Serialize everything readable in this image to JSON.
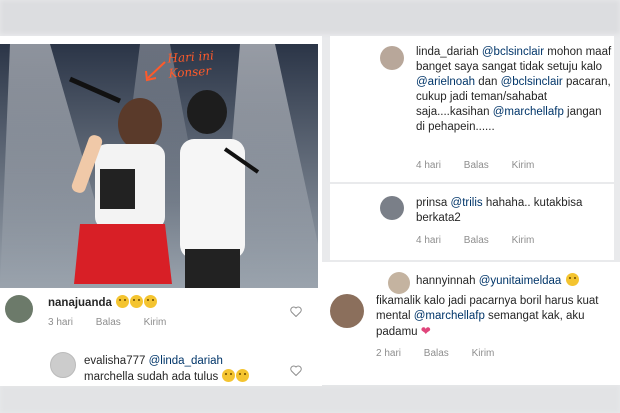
{
  "left": {
    "annotation": "Hari ini\nKonser",
    "comments": [
      {
        "user": "nanajuanda",
        "time": "3 hari",
        "reply": "Balas",
        "send": "Kirim"
      }
    ],
    "reply_comment": {
      "user": "evalisha777",
      "mention": "@linda_dariah",
      "text": "marchella sudah ada tulus"
    }
  },
  "right": {
    "comments": [
      {
        "user": "linda_dariah",
        "parts": [
          {
            "t": "@bclsinclair",
            "m": true
          },
          {
            "t": " mohon maaf banget saya sangat tidak setuju kalo ",
            "m": false
          },
          {
            "t": "@arielnoah",
            "m": true
          },
          {
            "t": " dan ",
            "m": false
          },
          {
            "t": "@bclsinclair",
            "m": true
          },
          {
            "t": " pacaran, cukup jadi teman/sahabat saja....kasihan ",
            "m": false
          },
          {
            "t": "@marchellafp",
            "m": true
          },
          {
            "t": " jangan di pehapein......",
            "m": false
          }
        ],
        "time": "4 hari",
        "reply": "Balas",
        "send": "Kirim"
      },
      {
        "user": "prinsa",
        "parts": [
          {
            "t": "@trilis",
            "m": true
          },
          {
            "t": " hahaha.. kutakbisa berkata2",
            "m": false
          }
        ],
        "time": "4 hari",
        "reply": "Balas",
        "send": "Kirim"
      },
      {
        "user": "hannyinnah",
        "parts": [
          {
            "t": "@yunitaimeldaa",
            "m": true
          }
        ]
      },
      {
        "user": "fikamalik",
        "parts": [
          {
            "t": " kalo jadi pacarnya boril harus kuat mental ",
            "m": false
          },
          {
            "t": "@marchellafp",
            "m": true
          },
          {
            "t": " semangat kak, aku padamu ",
            "m": false
          }
        ],
        "time": "2 hari",
        "reply": "Balas",
        "send": "Kirim"
      }
    ]
  },
  "colors": {
    "mention": "#003569",
    "meta": "#8e8e8e",
    "annotation": "#ff5a2a",
    "heart": "#e0457b"
  }
}
